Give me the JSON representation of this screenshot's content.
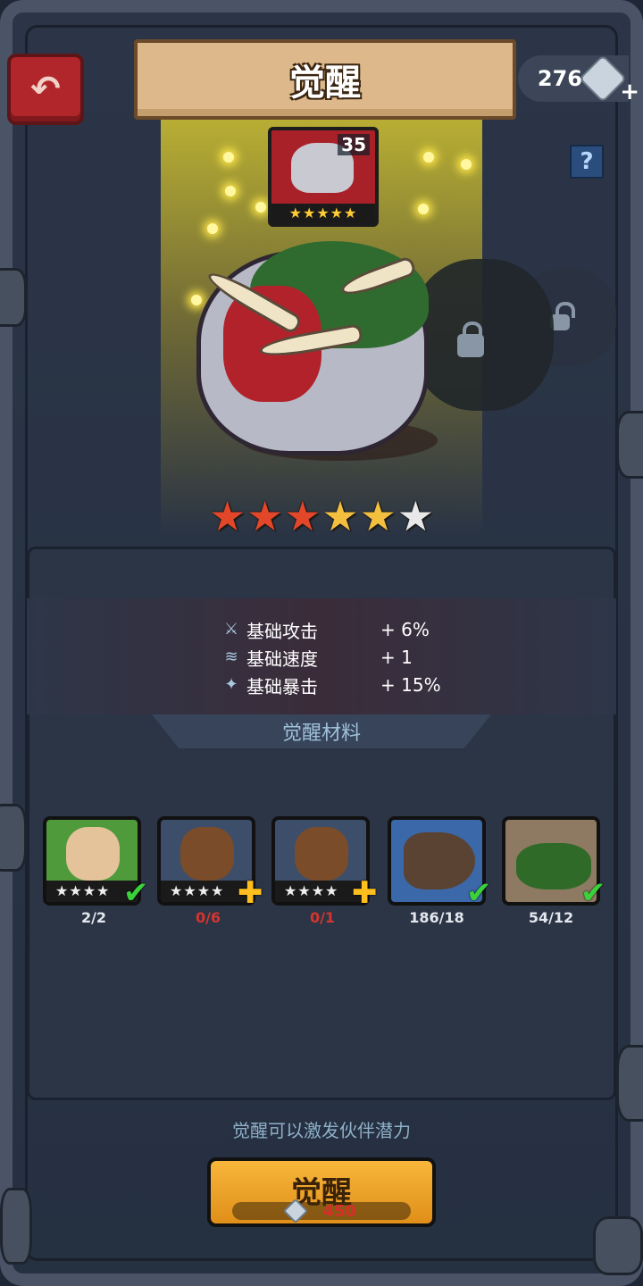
{
  "header": {
    "title": "觉醒",
    "currency_value": "276",
    "help_label": "?"
  },
  "hero": {
    "level": "35",
    "portrait_stars": "★★★★★",
    "awaken_stars_total": 6,
    "awaken_stars": [
      {
        "symbol": "★",
        "tone": "red"
      },
      {
        "symbol": "★",
        "tone": "red"
      },
      {
        "symbol": "★",
        "tone": "red"
      },
      {
        "symbol": "★",
        "tone": "gold"
      },
      {
        "symbol": "★",
        "tone": "gold"
      },
      {
        "symbol": "★",
        "tone": "white"
      }
    ]
  },
  "stats": [
    {
      "icon": "sword-icon",
      "label": "基础攻击",
      "value": "+ 6%"
    },
    {
      "icon": "wing-icon",
      "label": "基础速度",
      "value": "+ 1"
    },
    {
      "icon": "crit-icon",
      "label": "基础暴击",
      "value": "+ 15%"
    }
  ],
  "materials_title": "觉醒材料",
  "materials": [
    {
      "name": "green-hair-hero",
      "stars": "★★★★",
      "count": "2/2",
      "status": "complete"
    },
    {
      "name": "warrior-hero-1",
      "stars": "★★★★",
      "count": "0/6",
      "status": "add"
    },
    {
      "name": "warrior-hero-2",
      "stars": "★★★★",
      "count": "0/1",
      "status": "add"
    },
    {
      "name": "wood-log-item",
      "count": "186/18",
      "status": "complete"
    },
    {
      "name": "flower-bush-item",
      "count": "54/12",
      "status": "complete"
    }
  ],
  "hint": "觉醒可以激发伙伴潜力",
  "awaken_button": {
    "label": "觉醒",
    "cost": "450"
  },
  "colors": {
    "ok": "#3bd13b",
    "insufficient": "#d6342e",
    "add": "#ffbf1f",
    "button": "#f0a22b"
  }
}
